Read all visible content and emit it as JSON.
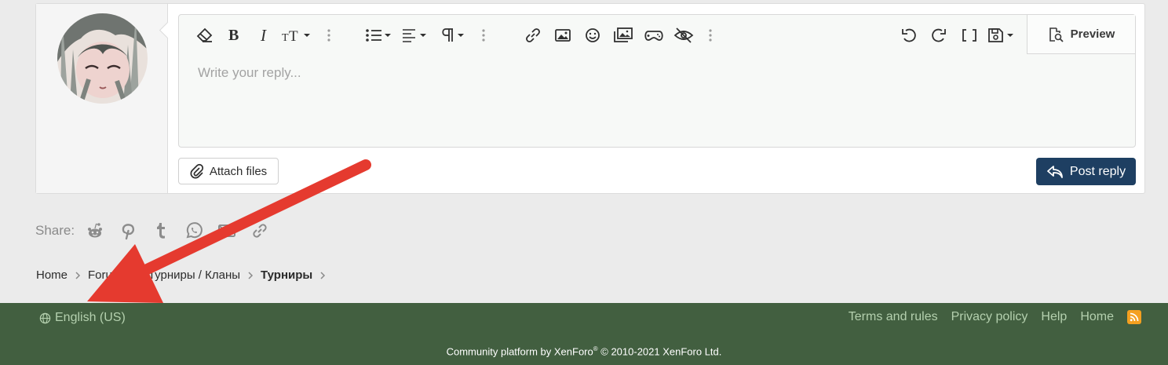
{
  "editor": {
    "placeholder": "Write your reply...",
    "preview_label": "Preview"
  },
  "toolbar_icons": [
    "eraser-icon",
    "bold-icon",
    "italic-icon",
    "text-size-icon",
    "list-icon",
    "align-icon",
    "paragraph-icon",
    "link-icon",
    "image-icon",
    "smiley-icon",
    "media-icon",
    "gif-icon",
    "spoiler-icon",
    "undo-icon",
    "redo-icon",
    "bb-code-icon",
    "drafts-icon"
  ],
  "buttons": {
    "attach": "Attach files",
    "post_reply": "Post reply"
  },
  "share": {
    "label": "Share:",
    "icons": [
      "reddit-icon",
      "pinterest-icon",
      "tumblr-icon",
      "whatsapp-icon",
      "email-icon",
      "link-icon"
    ]
  },
  "breadcrumb": {
    "items": [
      "Home",
      "Forums",
      "Турниры / Кланы",
      "Турниры"
    ]
  },
  "footer": {
    "language": "English (US)",
    "links": [
      "Terms and rules",
      "Privacy policy",
      "Help",
      "Home"
    ],
    "copyright_pre": "Community platform by XenForo",
    "copyright_reg": "®",
    "copyright_post": " © 2010-2021 XenForo Ltd."
  },
  "colors": {
    "footer_bg": "#425f40",
    "footer_link": "#b4d0ae",
    "post_button": "#1e3f62",
    "annotation_arrow": "#e53a2f",
    "rss": "#f4a020"
  }
}
